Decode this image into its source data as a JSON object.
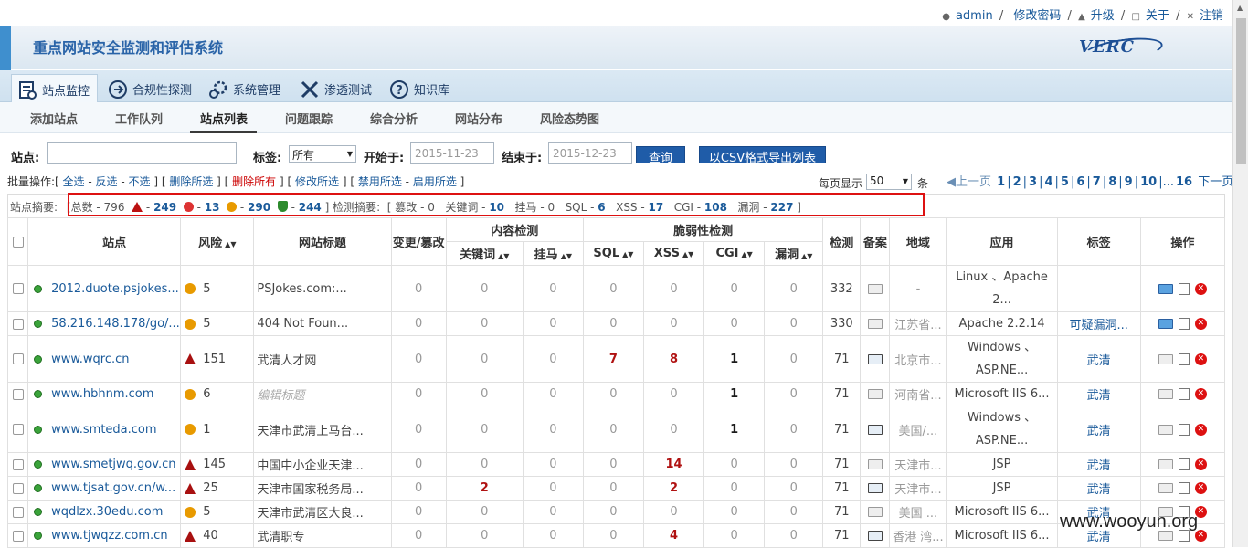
{
  "topbar": {
    "user": "admin",
    "change_password": "修改密码",
    "upgrade": "升级",
    "about": "关于",
    "logout": "注销",
    "sep": "/"
  },
  "banner": {
    "title": "重点网站安全监测和评估系统",
    "logo": "VERC"
  },
  "main_nav": [
    {
      "label": "站点监控",
      "icon": "monitor-doc-icon"
    },
    {
      "label": "合规性探测",
      "icon": "compliance-icon"
    },
    {
      "label": "系统管理",
      "icon": "gears-icon"
    },
    {
      "label": "渗透测试",
      "icon": "tools-icon"
    },
    {
      "label": "知识库",
      "icon": "question-icon"
    }
  ],
  "sub_nav": [
    "添加站点",
    "工作队列",
    "站点列表",
    "问题跟踪",
    "综合分析",
    "网站分布",
    "风险态势图"
  ],
  "filter": {
    "site_label": "站点:",
    "site_value": "",
    "tag_label": "标签:",
    "tag_value": "所有",
    "start_label": "开始于:",
    "start_value": "2015-11-23",
    "end_label": "结束于:",
    "end_value": "2015-12-23",
    "query": "查询",
    "export": "以CSV格式导出列表"
  },
  "batch": {
    "label": "批量操作:",
    "select_all": "全选",
    "invert": "反选",
    "select_none": "不选",
    "delete_selected": "删除所选",
    "delete_all": "删除所有",
    "modify_selected": "修改所选",
    "disable_selected": "禁用所选",
    "enable_selected": "启用所选"
  },
  "per_page": {
    "label": "每页显示",
    "value": "50",
    "unit": "条"
  },
  "pager": {
    "prev": "上一页",
    "pages": [
      "1",
      "2",
      "3",
      "4",
      "5",
      "6",
      "7",
      "8",
      "9",
      "10"
    ],
    "ellipsis": "...",
    "last": "16",
    "next": "下一页"
  },
  "summary": {
    "label": "站点摘要:",
    "total_label": "总数",
    "total": "796",
    "high": "249",
    "mid": "13",
    "low": "290",
    "safe": "244",
    "detect_label": "检测摘要:",
    "tamper_label": "篡改",
    "tamper": "0",
    "keyword_label": "关键词",
    "keyword": "10",
    "hang_label": "挂马",
    "hang": "0",
    "sql_label": "SQL",
    "sql": "6",
    "xss_label": "XSS",
    "xss": "17",
    "cgi_label": "CGI",
    "cgi": "108",
    "vuln_label": "漏洞",
    "vuln": "227"
  },
  "table": {
    "headers": {
      "site": "站点",
      "risk": "风险",
      "title": "网站标题",
      "tamper": "变更/篡改",
      "content": "内容检测",
      "keyword": "关键词",
      "hang": "挂马",
      "vuln_check": "脆弱性检测",
      "sql": "SQL",
      "xss": "XSS",
      "cgi": "CGI",
      "leak": "漏洞",
      "detect": "检测",
      "record": "备案",
      "region": "地域",
      "app": "应用",
      "tag": "标签",
      "ops": "操作"
    },
    "rows": [
      {
        "site": "2012.duote.psjokes...",
        "risk_level": "low",
        "risk": "5",
        "title": "PSJokes.com:...",
        "tamper": "0",
        "keyword": "0",
        "hang": "0",
        "sql": "0",
        "xss": "0",
        "cgi": "0",
        "leak": "0",
        "detect": "332",
        "record": "off",
        "region": "-",
        "app": "Linux 、Apache 2...",
        "tag": "",
        "tall": true,
        "monitor": "blue"
      },
      {
        "site": "58.216.148.178/go/...",
        "risk_level": "low",
        "risk": "5",
        "title": "404 Not Foun...",
        "tamper": "0",
        "keyword": "0",
        "hang": "0",
        "sql": "0",
        "xss": "0",
        "cgi": "0",
        "leak": "0",
        "detect": "330",
        "record": "off",
        "region": "江苏省...",
        "app": "Apache 2.2.14",
        "tag": "可疑漏洞...",
        "tall": false,
        "monitor": "blue"
      },
      {
        "site": "www.wqrc.cn",
        "risk_level": "high",
        "risk": "151",
        "title": "武清人才网",
        "tamper": "0",
        "keyword": "0",
        "hang": "0",
        "sql": "7",
        "xss": "8",
        "cgi": "1",
        "leak": "0",
        "detect": "71",
        "record": "on",
        "region": "北京市...",
        "app": "Windows 、ASP.NE...",
        "tag": "武清",
        "tall": true,
        "monitor": "gray"
      },
      {
        "site": "www.hbhnm.com",
        "risk_level": "low",
        "risk": "6",
        "title": "编辑标题",
        "title_italic": true,
        "tamper": "0",
        "keyword": "0",
        "hang": "0",
        "sql": "0",
        "xss": "0",
        "cgi": "1",
        "leak": "0",
        "detect": "71",
        "record": "off",
        "region": "河南省...",
        "app": "Microsoft IIS 6...",
        "tag": "武清",
        "tall": false,
        "monitor": "gray"
      },
      {
        "site": "www.smteda.com",
        "risk_level": "low",
        "risk": "1",
        "title": "天津市武清上马台...",
        "tamper": "0",
        "keyword": "0",
        "hang": "0",
        "sql": "0",
        "xss": "0",
        "cgi": "1",
        "leak": "0",
        "detect": "71",
        "record": "on",
        "region": "美国/...",
        "app": "Windows 、ASP.NE...",
        "tag": "武清",
        "tall": true,
        "monitor": "gray"
      },
      {
        "site": "www.smetjwq.gov.cn",
        "risk_level": "high",
        "risk": "145",
        "title": "中国中小企业天津...",
        "tamper": "0",
        "keyword": "0",
        "hang": "0",
        "sql": "0",
        "xss": "14",
        "cgi": "0",
        "leak": "0",
        "detect": "71",
        "record": "off",
        "region": "天津市...",
        "app": "JSP",
        "tag": "武清",
        "tall": false,
        "monitor": "gray"
      },
      {
        "site": "www.tjsat.gov.cn/w...",
        "risk_level": "high",
        "risk": "25",
        "title": "天津市国家税务局...",
        "tamper": "0",
        "keyword": "2",
        "hang": "0",
        "sql": "0",
        "xss": "2",
        "cgi": "0",
        "leak": "0",
        "detect": "71",
        "record": "on",
        "region": "天津市...",
        "app": "JSP",
        "tag": "武清",
        "tall": false,
        "monitor": "gray"
      },
      {
        "site": "wqdlzx.30edu.com",
        "risk_level": "low",
        "risk": "5",
        "title": "天津市武清区大良...",
        "tamper": "0",
        "keyword": "0",
        "hang": "0",
        "sql": "0",
        "xss": "0",
        "cgi": "0",
        "leak": "0",
        "detect": "71",
        "record": "off",
        "region": "美国 ...",
        "app": "Microsoft IIS 6...",
        "tag": "武清",
        "tall": false,
        "monitor": "gray"
      },
      {
        "site": "www.tjwqzz.com.cn",
        "risk_level": "high",
        "risk": "40",
        "title": "武清职专",
        "tamper": "0",
        "keyword": "0",
        "hang": "0",
        "sql": "0",
        "xss": "4",
        "cgi": "0",
        "leak": "0",
        "detect": "71",
        "record": "on",
        "region": "香港 湾...",
        "app": "Microsoft IIS 6...",
        "tag": "武清",
        "tall": false,
        "monitor": "gray"
      }
    ]
  },
  "watermark": "www.wooyun.org"
}
